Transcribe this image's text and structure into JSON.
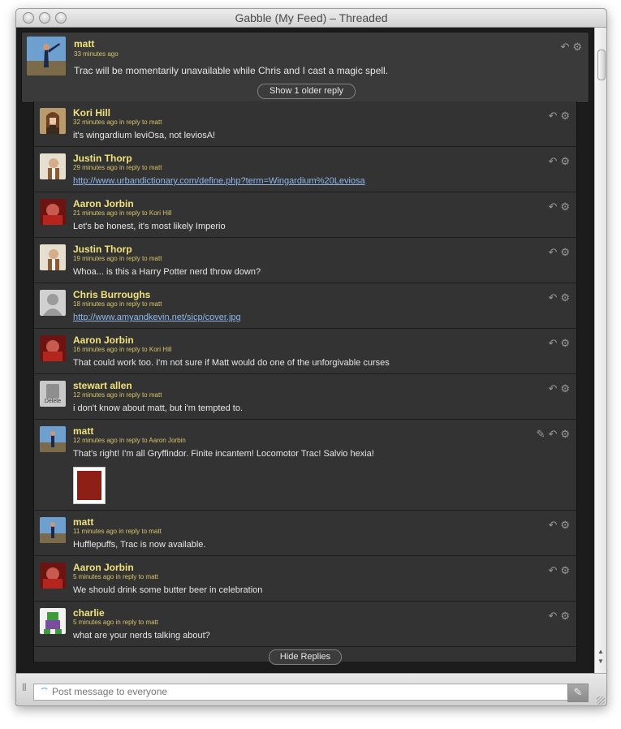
{
  "window": {
    "title": "Gabble (My Feed) – Threaded"
  },
  "parent": {
    "author": "matt",
    "time": "33 minutes ago",
    "text": "Trac will be momentarily unavailable while Chris and I cast a magic spell.",
    "show_older": "Show 1 older reply"
  },
  "replies": [
    {
      "author": "Kori Hill",
      "time": "32 minutes ago",
      "reply_prefix": "in reply to",
      "reply_to": "matt",
      "text": "it's wingardium leviOsa, not leviosA!"
    },
    {
      "author": "Justin Thorp",
      "time": "29 minutes ago",
      "reply_prefix": "in reply to",
      "reply_to": "matt",
      "link": "http://www.urbandictionary.com/define.php?term=Wingardium%20Leviosa"
    },
    {
      "author": "Aaron Jorbin",
      "time": "21 minutes ago",
      "reply_prefix": "in reply to",
      "reply_to": "Kori Hill",
      "text": "Let's be honest, it's most likely Imperio"
    },
    {
      "author": "Justin Thorp",
      "time": "19 minutes ago",
      "reply_prefix": "in reply to",
      "reply_to": "matt",
      "text": "Whoa... is this a Harry Potter nerd throw down?"
    },
    {
      "author": "Chris Burroughs",
      "time": "18 minutes ago",
      "reply_prefix": "in reply to",
      "reply_to": "matt",
      "link": "http://www.amyandkevin.net/sicp/cover.jpg"
    },
    {
      "author": "Aaron Jorbin",
      "time": "16 minutes ago",
      "reply_prefix": "in reply to",
      "reply_to": "Kori Hill",
      "text": "That could work too. I'm not sure if Matt would do one of the unforgivable curses"
    },
    {
      "author": "stewart allen",
      "time": "12 minutes ago",
      "reply_prefix": "in reply to",
      "reply_to": "matt",
      "text": "i don't know about matt, but i'm tempted to.",
      "avatar_label": "Delete"
    },
    {
      "author": "matt",
      "time": "12 minutes ago",
      "reply_prefix": "in reply to",
      "reply_to": "Aaron Jorbin",
      "text": "That's right! I'm all Gryffindor. Finite incantem! Locomotor Trac! Salvio hexia!"
    },
    {
      "author": "matt",
      "time": "11 minutes ago",
      "reply_prefix": "in reply to",
      "reply_to": "matt",
      "text": "Hufflepuffs, Trac is now available."
    },
    {
      "author": "Aaron Jorbin",
      "time": "5 minutes ago",
      "reply_prefix": "in reply to",
      "reply_to": "matt",
      "text": "We should drink some butter beer in celebration"
    },
    {
      "author": "charlie",
      "time": "5 minutes ago",
      "reply_prefix": "in reply to",
      "reply_to": "matt",
      "text": "what are your nerds talking about?"
    }
  ],
  "hide_replies": "Hide Replies",
  "composer": {
    "placeholder": "Post message to everyone"
  },
  "colors": {
    "name": "#f2e27a",
    "meta": "#d8c469",
    "link": "#8fb6e8",
    "background": "#333333"
  },
  "icons": {
    "reply": "reply-icon",
    "settings": "gear-icon",
    "attachment": "paperclip-icon"
  }
}
